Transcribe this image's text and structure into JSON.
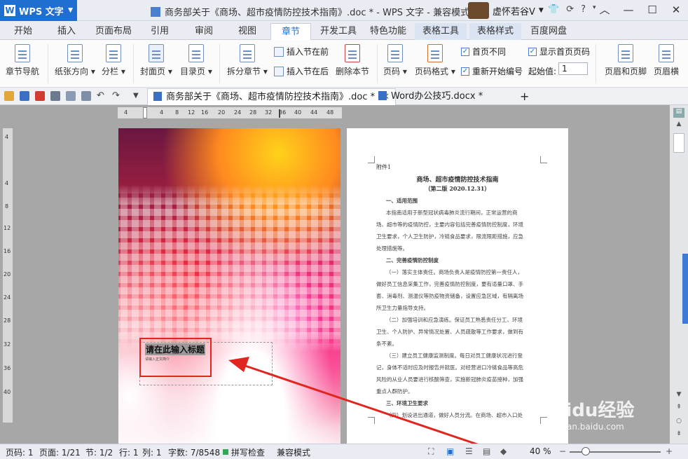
{
  "app": {
    "name": "WPS 文字",
    "logo": "W"
  },
  "window_title": "商务部关于《商场、超市疫情防控技术指南》.doc * - WPS 文字 - 兼容模式",
  "user": {
    "name": "虚怀若谷V"
  },
  "menu_tabs": [
    "开始",
    "插入",
    "页面布局",
    "引用",
    "审阅",
    "视图",
    "章节",
    "开发工具",
    "特色功能",
    "表格工具",
    "表格样式",
    "百度网盘"
  ],
  "active_tab": "章节",
  "ribbon": {
    "chapter_nav": "章节导航",
    "orientation": "纸张方向",
    "columns": "分栏",
    "cover": "封面页",
    "toc": "目录页",
    "split_chapter": "拆分章节",
    "insert_before": "插入节在前",
    "insert_after": "插入节在后",
    "delete_section": "删除本节",
    "page_number": "页码",
    "page_number_format": "页码格式",
    "first_page_diff": "首页不同",
    "show_first_page_number": "显示首页页码",
    "restart_numbering": "重新开始编号",
    "start_value_label": "起始值:",
    "start_value": "1",
    "header_footer": "页眉和页脚",
    "header_cut": "页眉横"
  },
  "doc_tabs": [
    {
      "label": "商务部关于《商场、超市疫情防控技术指南》.doc *",
      "active": true
    },
    {
      "label": "Word办公技巧.docx *",
      "active": false
    }
  ],
  "new_tab": "+",
  "ruler_h": [
    "4",
    "4",
    "8",
    "12",
    "16",
    "20",
    "24",
    "28",
    "32",
    "",
    "36",
    "40",
    "44",
    "48"
  ],
  "ruler_v": [
    "4",
    "",
    "4",
    "8",
    "12",
    "16",
    "20",
    "24",
    "28",
    "32",
    "36",
    "40"
  ],
  "cover_page": {
    "title": "请在此输入标题",
    "subtitle": "请输入正文简介"
  },
  "page2": {
    "attachment": "附件1",
    "title": "商场、超市疫情防控技术指南",
    "edition": "（第二版 2020.12.31）",
    "lines": [
      "一、适用范围",
      "本指南适用于新型冠状病毒肺炎流行期间，正常运营的商",
      "场、超市等的疫情防控，主要内容包括完善疫情防控制度，环境",
      "卫生要求，个人卫生防护，冷链食品要求，限流限距措施，应急",
      "处理措施等。",
      "二、完善疫情防控制度",
      "（一）落实主体责任。商场负责人是疫情防控第一责任人，",
      "做好员工信息采集工作，完善疫情防控制度，要有适量口罩、手",
      "套、消毒剂、测温仪等防疫物资储备，设置应急区域，有隔离场",
      "所卫生力量指导支持。",
      "（二）加强培训和应急演练。保证员工熟悉责任分工、环境",
      "卫生、个人防护、异常情况处置、人员疏散等工作要求，做到有",
      "条不紊。",
      "（三）建立员工健康监测制度。每日对员工健康状况进行登",
      "记，身体不适时应及时报告并就医。对经营进口冷链食品等高危",
      "风险的从业人员要进行核酸筛查，实施新冠肺炎疫苗接种，加强",
      "重点人群防护。",
      "三、环境卫生要求",
      "（四）划设进出通道，做好人员分流。在商场、超市入口处"
    ]
  },
  "status": {
    "page": "页码: 1",
    "pages": "页面: 1/21",
    "section": "节: 1/2",
    "row": "行: 1",
    "col": "列: 1",
    "words": "字数: 7/8548",
    "spell": "拼写检查",
    "mode": "兼容模式",
    "zoom": "40 %"
  },
  "watermark": {
    "brand": "Baidu经验",
    "url": "jingyan.baidu.com"
  },
  "colors": {
    "brand_blue": "#1f6fd1",
    "annotation_red": "#e0261e"
  }
}
